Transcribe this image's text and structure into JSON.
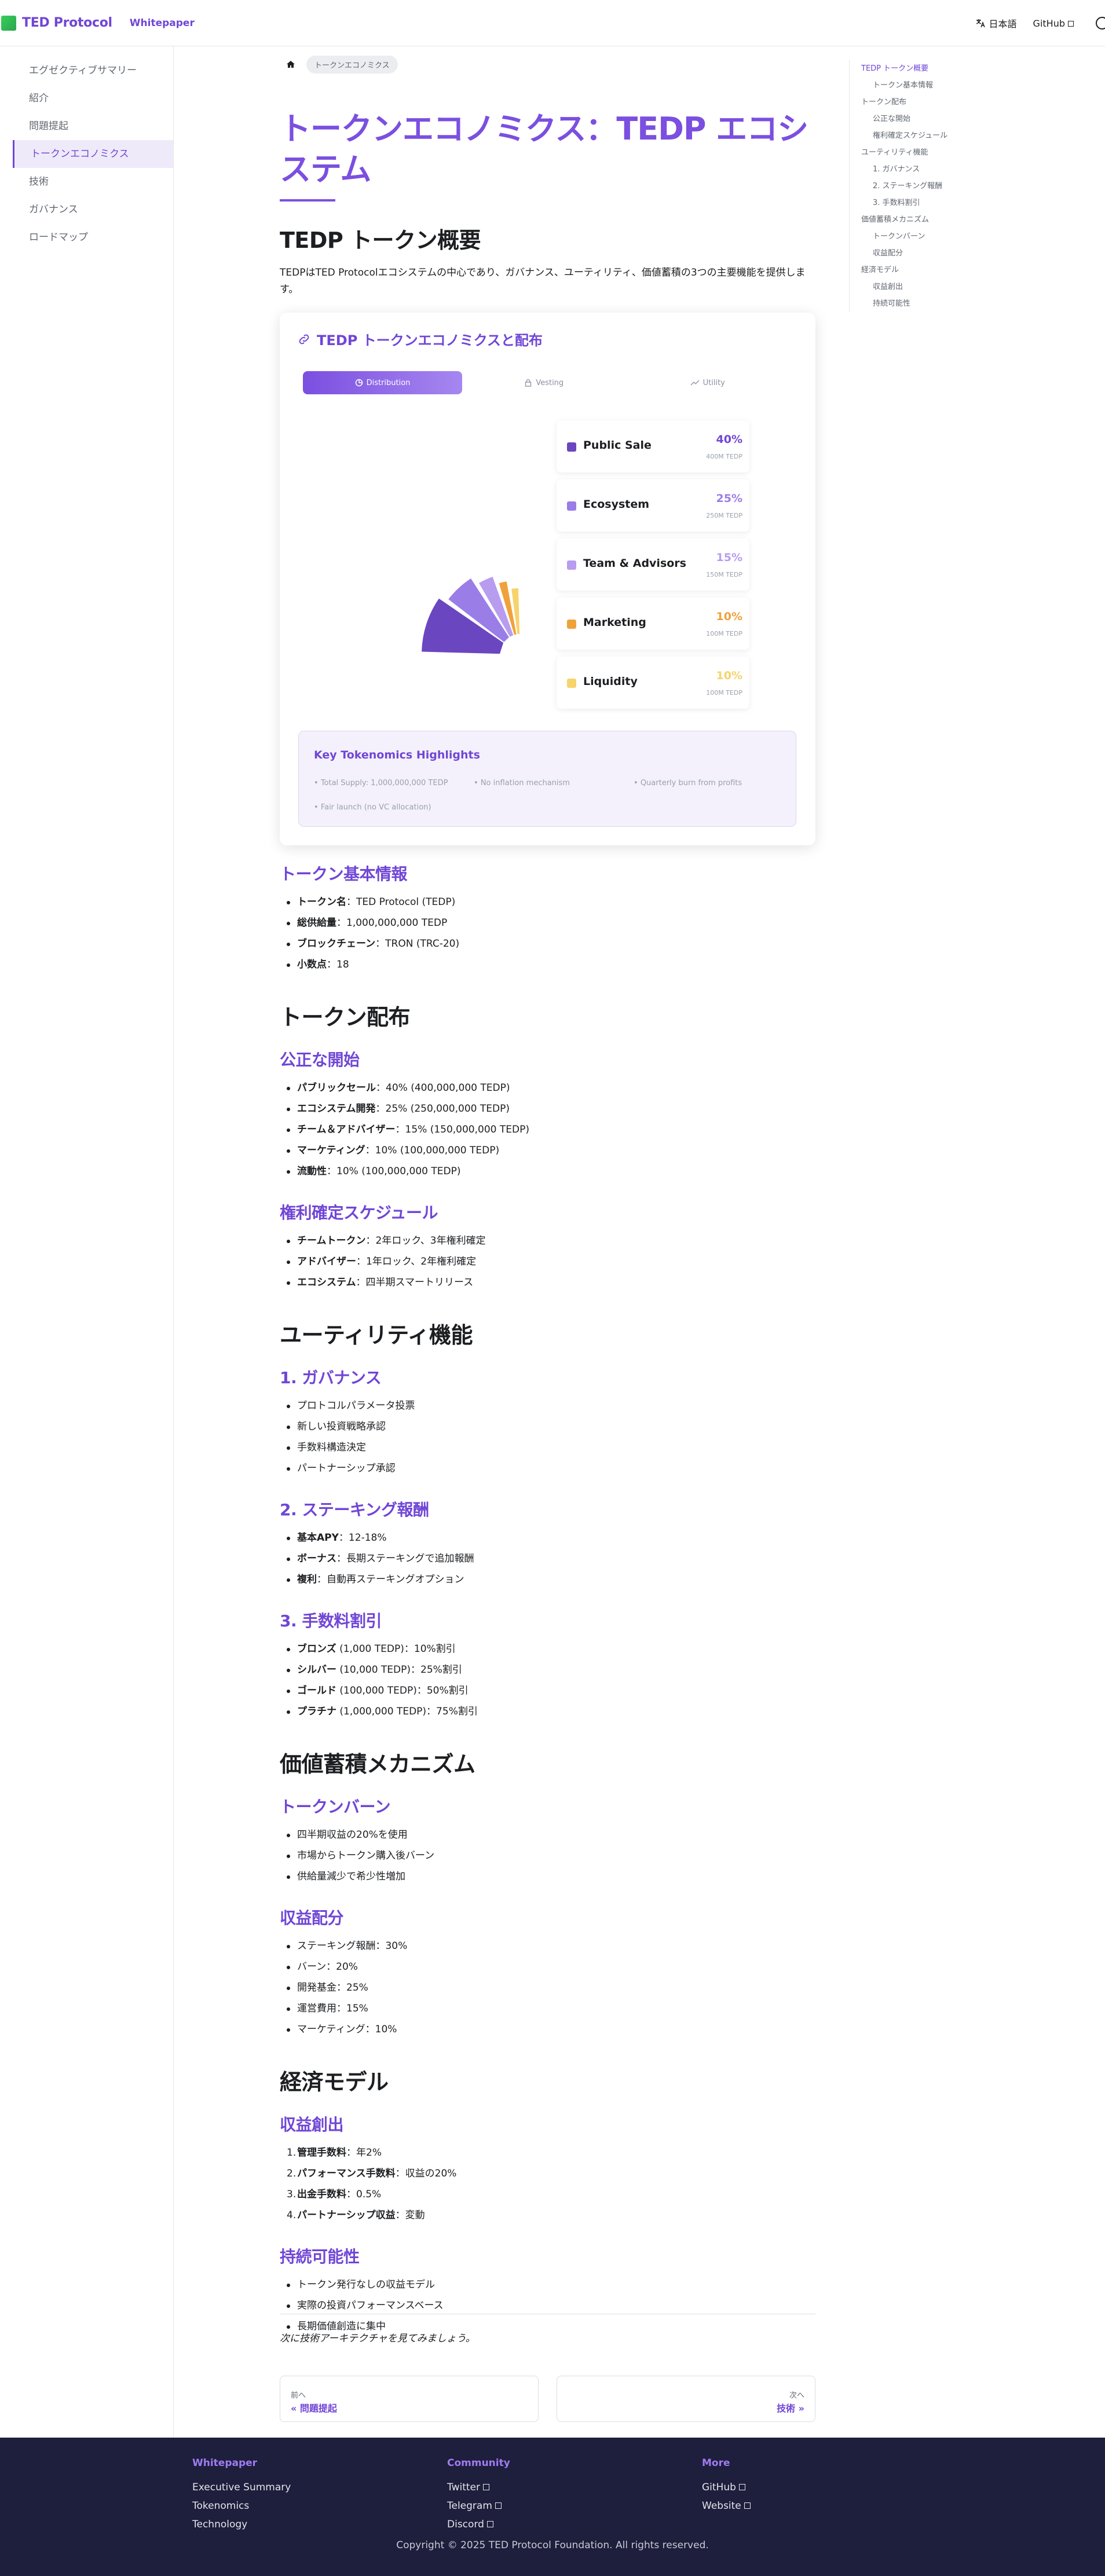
{
  "navbar": {
    "brand": "TED Protocol",
    "whitepaper": "Whitepaper",
    "language": "日本語",
    "github": "GitHub"
  },
  "sidebar": {
    "items": [
      {
        "label": "エグゼクティブサマリー"
      },
      {
        "label": "紹介"
      },
      {
        "label": "問題提起"
      },
      {
        "label": "トークンエコノミクス"
      },
      {
        "label": "技術"
      },
      {
        "label": "ガバナンス"
      },
      {
        "label": "ロードマップ"
      }
    ]
  },
  "toc": {
    "items": [
      {
        "label": "TEDP トークン概要"
      },
      {
        "label": "トークン基本情報"
      },
      {
        "label": "トークン配布"
      },
      {
        "label": "公正な開始"
      },
      {
        "label": "権利確定スケジュール"
      },
      {
        "label": "ユーティリティ機能"
      },
      {
        "label": "1. ガバナンス"
      },
      {
        "label": "2. ステーキング報酬"
      },
      {
        "label": "3. 手数料割引"
      },
      {
        "label": "価値蓄積メカニズム"
      },
      {
        "label": "トークンバーン"
      },
      {
        "label": "収益配分"
      },
      {
        "label": "経済モデル"
      },
      {
        "label": "収益創出"
      },
      {
        "label": "持続可能性"
      }
    ]
  },
  "breadcrumb": {
    "current": "トークンエコノミクス"
  },
  "page": {
    "title": "トークンエコノミクス：TEDP エコシステム",
    "overview_heading": "TEDP トークン概要",
    "overview_text": "TEDPはTED Protocolエコシステムの中心であり、ガバナンス、ユーティリティ、価値蓄積の3つの主要機能を提供します。"
  },
  "card": {
    "title": "TEDP トークンエコノミクスと配布",
    "tabs": [
      "Distribution",
      "Vesting",
      "Utility"
    ],
    "highlights_title": "Key Tokenomics Highlights",
    "highlights": [
      "Total Supply: 1,000,000,000 TEDP",
      "No inflation mechanism",
      "Quarterly burn from profits",
      "Fair launch (no VC allocation)"
    ]
  },
  "chart_data": {
    "type": "pie",
    "title": "",
    "categories": [
      "Public Sale",
      "Ecosystem",
      "Team & Advisors",
      "Marketing",
      "Liquidity"
    ],
    "values": [
      40,
      25,
      15,
      10,
      10
    ],
    "percent_labels": [
      "40%",
      "25%",
      "15%",
      "10%",
      "10%"
    ],
    "amount_labels": [
      "400M TEDP",
      "250M TEDP",
      "150M TEDP",
      "100M TEDP",
      "100M TEDP"
    ],
    "colors": [
      "#6b46c1",
      "#9b7de8",
      "#b79cf0",
      "#f0a23a",
      "#f7d36b"
    ]
  },
  "token_info": {
    "heading": "トークン基本情報",
    "items": [
      {
        "k": "トークン名",
        "v": "：TED Protocol (TEDP)"
      },
      {
        "k": "総供給量",
        "v": "：1,000,000,000 TEDP"
      },
      {
        "k": "ブロックチェーン",
        "v": "：TRON (TRC-20)"
      },
      {
        "k": "小数点",
        "v": "：18"
      }
    ]
  },
  "distribution": {
    "heading": "トークン配布",
    "fair_heading": "公正な開始",
    "fair_items": [
      {
        "k": "パブリックセール",
        "v": "：40% (400,000,000 TEDP)"
      },
      {
        "k": "エコシステム開発",
        "v": "：25% (250,000,000 TEDP)"
      },
      {
        "k": "チーム＆アドバイザー",
        "v": "：15% (150,000,000 TEDP)"
      },
      {
        "k": "マーケティング",
        "v": "：10% (100,000,000 TEDP)"
      },
      {
        "k": "流動性",
        "v": "：10% (100,000,000 TEDP)"
      }
    ],
    "vesting_heading": "権利確定スケジュール",
    "vesting_items": [
      {
        "k": "チームトークン",
        "v": "：2年ロック、3年権利確定"
      },
      {
        "k": "アドバイザー",
        "v": "：1年ロック、2年権利確定"
      },
      {
        "k": "エコシステム",
        "v": "：四半期スマートリリース"
      }
    ]
  },
  "utility": {
    "heading": "ユーティリティ機能",
    "gov_heading": "1. ガバナンス",
    "gov_items": [
      "プロトコルパラメータ投票",
      "新しい投資戦略承認",
      "手数料構造決定",
      "パートナーシップ承認"
    ],
    "staking_heading": "2. ステーキング報酬",
    "staking_items": [
      {
        "k": "基本APY",
        "v": "：12-18%"
      },
      {
        "k": "ボーナス",
        "v": "：長期ステーキングで追加報酬"
      },
      {
        "k": "複利",
        "v": "：自動再ステーキングオプション"
      }
    ],
    "fee_heading": "3. 手数料割引",
    "fee_items": [
      {
        "k": "ブロンズ",
        "v": " (1,000 TEDP)：10%割引"
      },
      {
        "k": "シルバー",
        "v": " (10,000 TEDP)：25%割引"
      },
      {
        "k": "ゴールド",
        "v": " (100,000 TEDP)：50%割引"
      },
      {
        "k": "プラチナ",
        "v": " (1,000,000 TEDP)：75%割引"
      }
    ]
  },
  "value": {
    "heading": "価値蓄積メカニズム",
    "burn_heading": "トークンバーン",
    "burn_items": [
      "四半期収益の20%を使用",
      "市場からトークン購入後バーン",
      "供給量減少で希少性増加"
    ],
    "rev_heading": "収益配分",
    "rev_items": [
      "ステーキング報酬：30%",
      "バーン：20%",
      "開発基金：25%",
      "運営費用：15%",
      "マーケティング：10%"
    ]
  },
  "econ": {
    "heading": "経済モデル",
    "rev_heading": "収益創出",
    "rev_items": [
      {
        "n": "1.",
        "k": "管理手数料",
        "v": "：年2%"
      },
      {
        "n": "2.",
        "k": "パフォーマンス手数料",
        "v": "：収益の20%"
      },
      {
        "n": "3.",
        "k": "出金手数料",
        "v": "：0.5%"
      },
      {
        "n": "4.",
        "k": "パートナーシップ収益",
        "v": "：変動"
      }
    ],
    "sus_heading": "持続可能性",
    "sus_items": [
      "トークン発行なしの収益モデル",
      "実際の投資パフォーマンスベース",
      "長期価値創造に集中"
    ]
  },
  "closing": "次に技術アーキテクチャを見てみましょう。",
  "pager": {
    "prev_sub": "前へ",
    "prev_label": "« 問題提起",
    "next_sub": "次へ",
    "next_label": "技術 »"
  },
  "footer": {
    "cols": [
      {
        "title": "Whitepaper",
        "links": [
          "Executive Summary",
          "Tokenomics",
          "Technology"
        ]
      },
      {
        "title": "Community",
        "links": [
          "Twitter",
          "Telegram",
          "Discord"
        ]
      },
      {
        "title": "More",
        "links": [
          "GitHub",
          "Website"
        ]
      }
    ],
    "copyright": "Copyright © 2025 TED Protocol Foundation. All rights reserved."
  }
}
